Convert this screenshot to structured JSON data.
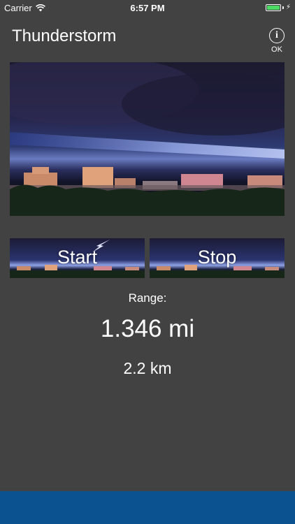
{
  "status_bar": {
    "carrier": "Carrier",
    "time": "6:57 PM",
    "battery_level": 1.0,
    "battery_color": "#4cd964"
  },
  "header": {
    "title": "Thunderstorm",
    "info_icon": "info-icon",
    "info_label": "OK"
  },
  "buttons": {
    "start_label": "Start",
    "stop_label": "Stop"
  },
  "readout": {
    "range_label": "Range:",
    "miles": "1.346 mi",
    "km": "2.2 km"
  },
  "colors": {
    "background": "#424242",
    "bottom_bar": "#0b5390"
  }
}
